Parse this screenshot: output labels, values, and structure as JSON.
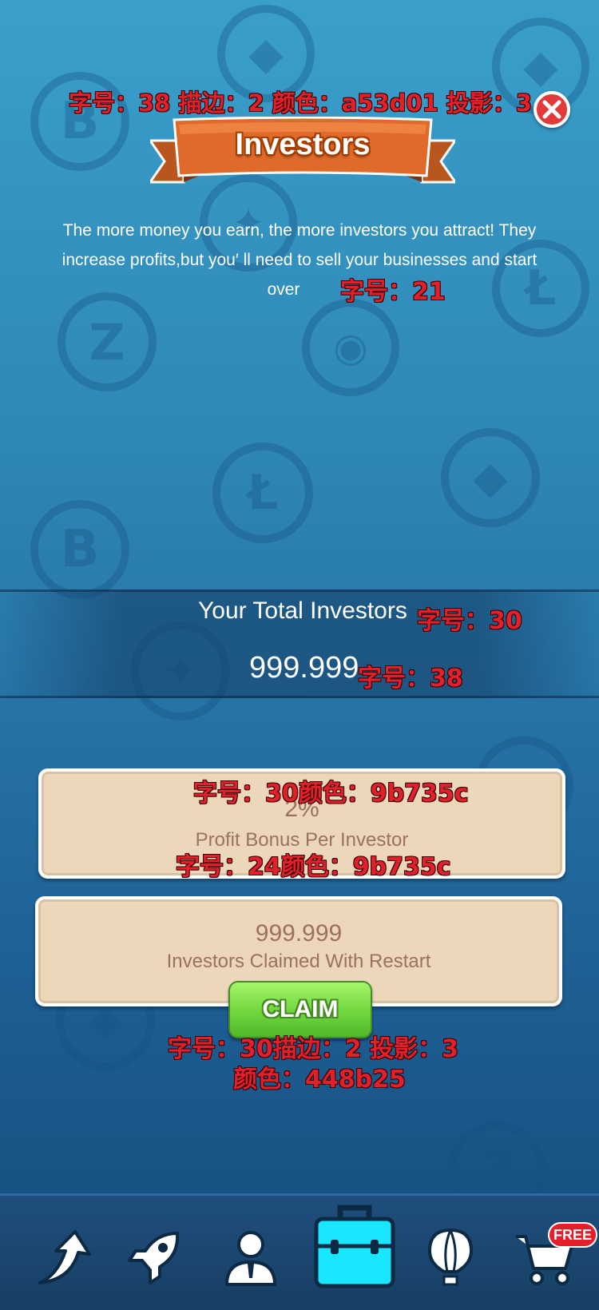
{
  "header": {
    "title": "Investors",
    "title_annotation": "字号：38 描边：2 颜色：a53d01 投影：3"
  },
  "description": {
    "line1": "The more money you earn, the more investors you attract! They",
    "line2": "increase profits,but you′ ll need to sell your businesses and start",
    "line3": "over",
    "annotation": "字号：21"
  },
  "total": {
    "label": "Your Total Investors",
    "label_annotation": "字号：30",
    "value": "999.999",
    "value_annotation": "字号：38"
  },
  "bonus_card": {
    "top_annotation": "字号：30颜色：9b735c",
    "value": "2%",
    "label": "Profit Bonus Per Investor",
    "bottom_annotation": "字号：24颜色：9b735c"
  },
  "restart_card": {
    "value": "999.999",
    "label": "Investors Claimed With Restart"
  },
  "claim": {
    "label": "CLAIM",
    "annotation_line1": "字号：30描边：2 投影：3",
    "annotation_line2": "颜色：448b25"
  },
  "nav": {
    "items": [
      "upgrade-icon",
      "rocket-icon",
      "manager-icon",
      "briefcase-icon",
      "balloon-icon",
      "cart-icon"
    ],
    "active": "briefcase-icon",
    "free_badge": "FREE"
  },
  "colors": {
    "ribbon": "#e06a2a",
    "ribbon_stroke": "#a53d01",
    "card_text": "#9b735c",
    "claim_stroke": "#448b25",
    "active_nav": "#19e6ff"
  }
}
